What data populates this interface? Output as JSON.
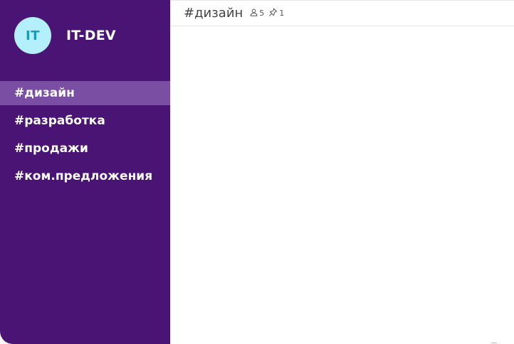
{
  "workspace": {
    "avatar_initials": "IT",
    "name": "IT-DEV"
  },
  "channels": [
    {
      "label": "#дизайн",
      "active": true
    },
    {
      "label": "#разработка",
      "active": false
    },
    {
      "label": "#продажи",
      "active": false
    },
    {
      "label": "#ком.предложения",
      "active": false
    }
  ],
  "header": {
    "title": "#дизайн",
    "members_count": "5",
    "pinned_count": "1",
    "members_icon": "user-icon",
    "pinned_icon": "pin-icon"
  },
  "colors": {
    "sidebar_bg": "#4a1474",
    "active_channel_bg": "#7a4fa3",
    "avatar_bg": "#b3f0fb",
    "avatar_text": "#1a9bb8"
  }
}
